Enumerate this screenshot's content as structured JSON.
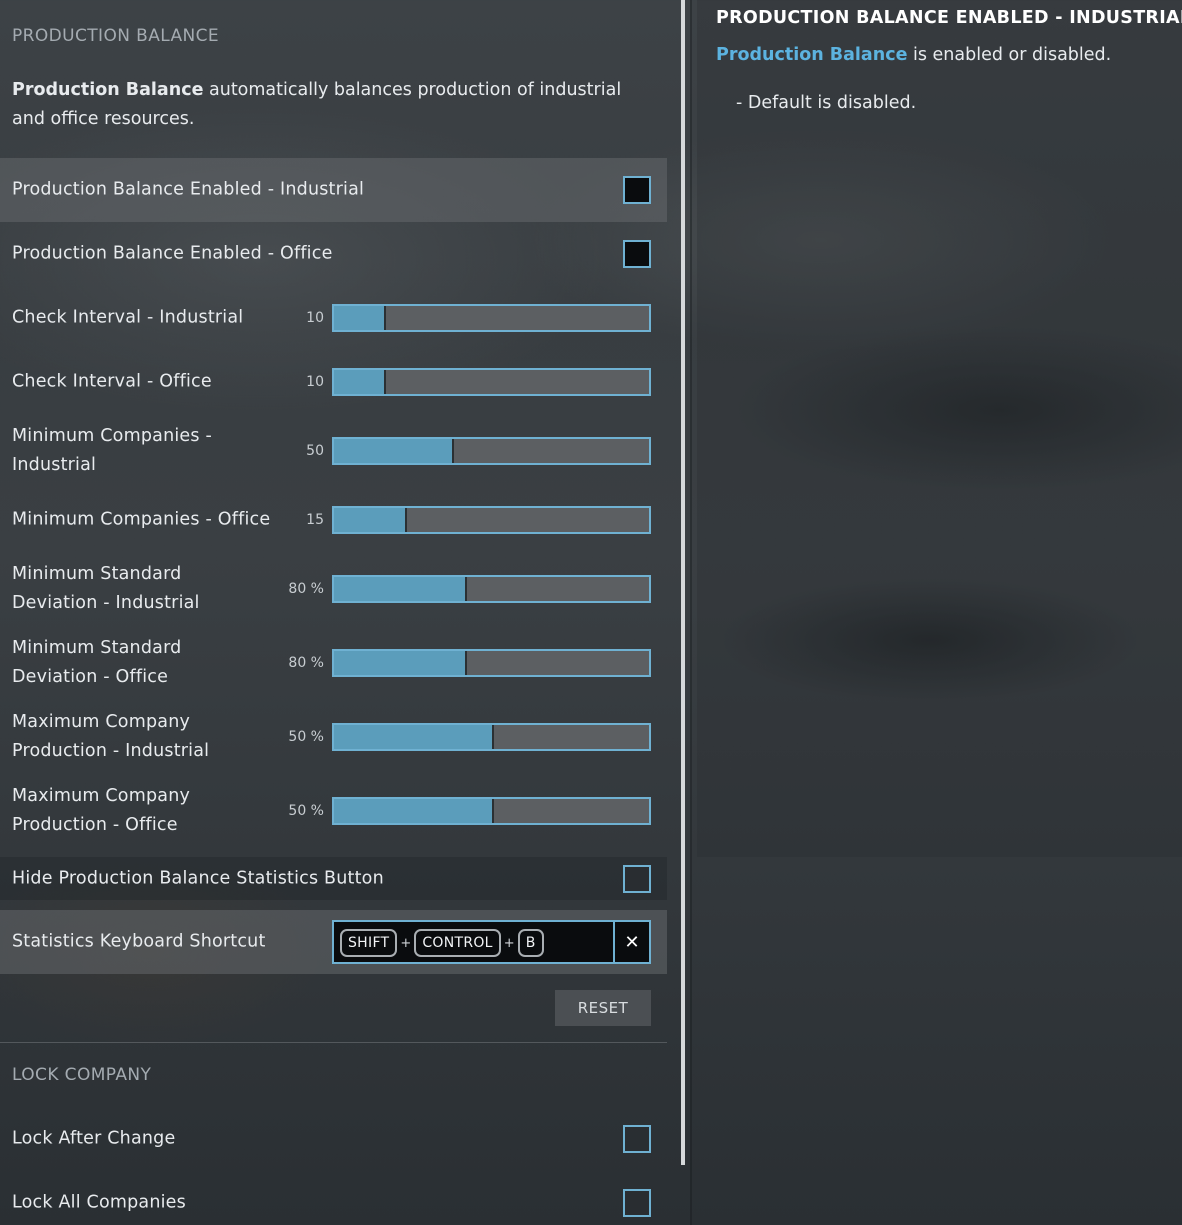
{
  "colors": {
    "accent": "#6fb1d2",
    "slider_fill": "#5b9dbb",
    "link": "#5cb3e0"
  },
  "production_balance": {
    "section_title": "PRODUCTION BALANCE",
    "intro_bold": "Production Balance",
    "intro_rest": " automatically balances production of industrial and office resources.",
    "enabled_industrial": {
      "label": "Production Balance Enabled - Industrial",
      "checked": false
    },
    "enabled_office": {
      "label": "Production Balance Enabled - Office",
      "checked": false
    },
    "sliders": [
      {
        "label": "Check Interval - Industrial",
        "value": "10",
        "fill_fraction": 0.16
      },
      {
        "label": "Check Interval - Office",
        "value": "10",
        "fill_fraction": 0.16
      },
      {
        "label": "Minimum Companies - Industrial",
        "value": "50",
        "fill_fraction": 0.375
      },
      {
        "label": "Minimum Companies - Office",
        "value": "15",
        "fill_fraction": 0.225
      },
      {
        "label": "Minimum Standard Deviation - Industrial",
        "value": "80 %",
        "fill_fraction": 0.415
      },
      {
        "label": "Minimum Standard Deviation - Office",
        "value": "80 %",
        "fill_fraction": 0.415
      },
      {
        "label": "Maximum Company Production - Industrial",
        "value": "50 %",
        "fill_fraction": 0.5
      },
      {
        "label": "Maximum Company Production - Office",
        "value": "50 %",
        "fill_fraction": 0.5
      }
    ],
    "hide_stats_button": {
      "label": "Hide Production Balance Statistics Button",
      "checked": false
    },
    "keyboard_shortcut": {
      "label": "Statistics Keyboard Shortcut",
      "keys": [
        "SHIFT",
        "CONTROL",
        "B"
      ],
      "separator": "+",
      "clear_icon": "close-icon",
      "clear_glyph": "✕"
    },
    "reset_label": "RESET"
  },
  "lock_company": {
    "section_title": "LOCK COMPANY",
    "lock_after_change": {
      "label": "Lock After Change",
      "checked": false
    },
    "lock_all_companies": {
      "label": "Lock All Companies",
      "checked": false
    }
  },
  "description": {
    "title": "PRODUCTION BALANCE ENABLED - INDUSTRIAL",
    "accent_text": "Production Balance",
    "rest_text": " is enabled or disabled.",
    "default_text": "- Default is disabled."
  }
}
